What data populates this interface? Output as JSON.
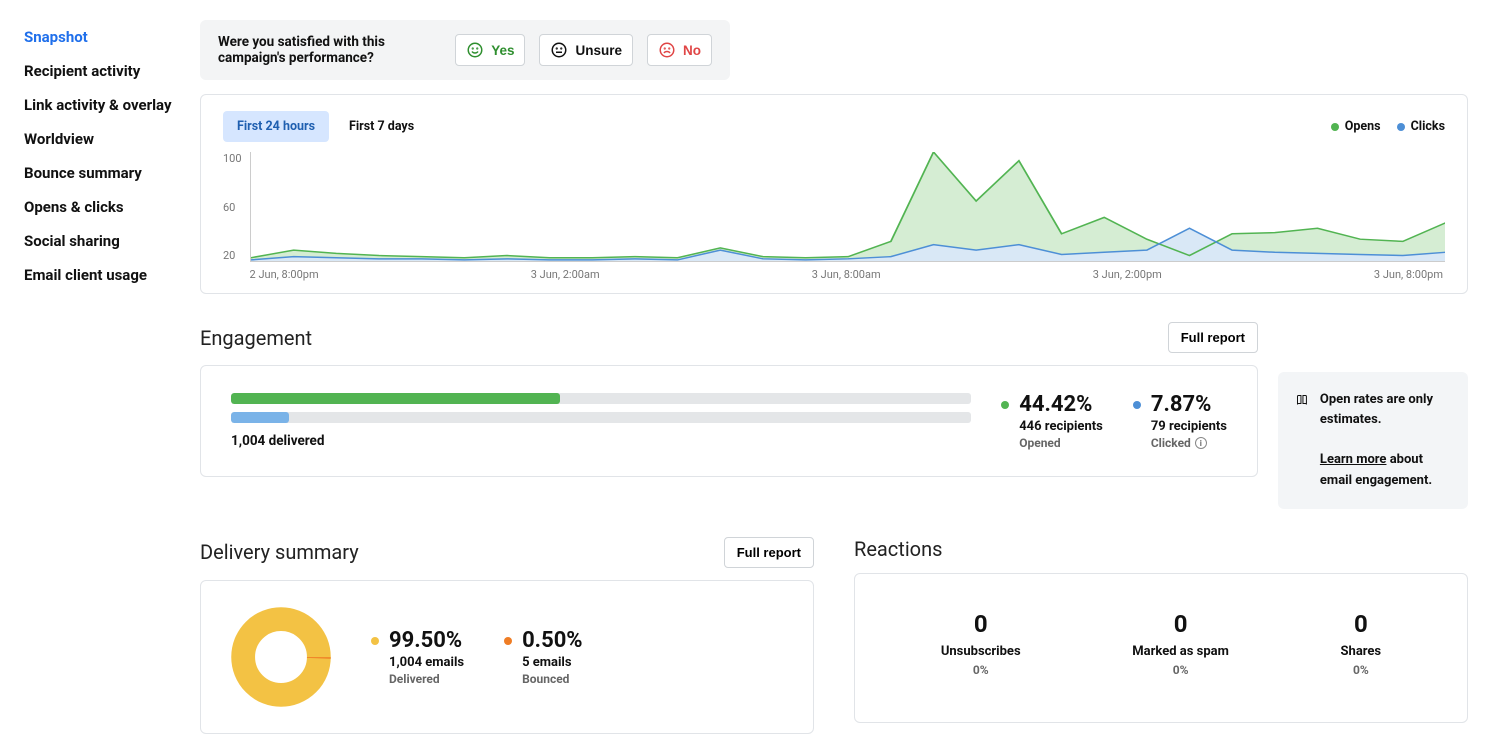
{
  "sidebar": {
    "items": [
      {
        "label": "Snapshot",
        "active": true
      },
      {
        "label": "Recipient activity"
      },
      {
        "label": "Link activity & overlay"
      },
      {
        "label": "Worldview"
      },
      {
        "label": "Bounce summary"
      },
      {
        "label": "Opens & clicks"
      },
      {
        "label": "Social sharing"
      },
      {
        "label": "Email client usage"
      }
    ]
  },
  "feedback": {
    "question": "Were you satisfied with this campaign's performance?",
    "yes": "Yes",
    "unsure": "Unsure",
    "no": "No"
  },
  "chart": {
    "range24": "First 24 hours",
    "range7": "First 7 days",
    "legend_opens": "Opens",
    "legend_clicks": "Clicks",
    "y_ticks": [
      "100",
      "60",
      "20"
    ],
    "x_ticks": [
      "2 Jun, 8:00pm",
      "3 Jun, 2:00am",
      "3 Jun, 8:00am",
      "3 Jun, 2:00pm",
      "3 Jun, 8:00pm"
    ]
  },
  "engagement": {
    "title": "Engagement",
    "full_report": "Full report",
    "delivered_label": "1,004 delivered",
    "open_pct": "44.42%",
    "open_sub": "446 recipients",
    "open_lbl": "Opened",
    "click_pct": "7.87%",
    "click_sub": "79 recipients",
    "click_lbl": "Clicked",
    "aside_line1": "Open rates are only estimates.",
    "aside_link": "Learn more",
    "aside_line2": " about email engagement."
  },
  "delivery": {
    "title": "Delivery summary",
    "full_report": "Full report",
    "delivered_pct": "99.50%",
    "delivered_sub": "1,004 emails",
    "delivered_lbl": "Delivered",
    "bounced_pct": "0.50%",
    "bounced_sub": "5 emails",
    "bounced_lbl": "Bounced"
  },
  "reactions": {
    "title": "Reactions",
    "cols": [
      {
        "val": "0",
        "label": "Unsubscribes",
        "pct": "0%"
      },
      {
        "val": "0",
        "label": "Marked as spam",
        "pct": "0%"
      },
      {
        "val": "0",
        "label": "Shares",
        "pct": "0%"
      }
    ]
  },
  "chart_data": {
    "type": "area",
    "x": [
      "2 Jun, 8:00pm",
      "2 Jun, 9:00pm",
      "2 Jun, 10:00pm",
      "2 Jun, 11:00pm",
      "3 Jun, 12:00am",
      "3 Jun, 1:00am",
      "3 Jun, 2:00am",
      "3 Jun, 3:00am",
      "3 Jun, 4:00am",
      "3 Jun, 5:00am",
      "3 Jun, 6:00am",
      "3 Jun, 7:00am",
      "3 Jun, 8:00am",
      "3 Jun, 9:00am",
      "3 Jun, 10:00am",
      "3 Jun, 11:00am",
      "3 Jun, 12:00pm",
      "3 Jun, 1:00pm",
      "3 Jun, 2:00pm",
      "3 Jun, 3:00pm",
      "3 Jun, 4:00pm",
      "3 Jun, 5:00pm",
      "3 Jun, 6:00pm",
      "3 Jun, 7:00pm",
      "3 Jun, 8:00pm"
    ],
    "series": [
      {
        "name": "Opens",
        "values": [
          3,
          10,
          7,
          5,
          4,
          3,
          5,
          3,
          3,
          4,
          3,
          12,
          4,
          3,
          4,
          18,
          100,
          55,
          92,
          25,
          40,
          20,
          5,
          25,
          26,
          30,
          20,
          18,
          35
        ]
      },
      {
        "name": "Clicks",
        "values": [
          1,
          4,
          3,
          2,
          2,
          1,
          2,
          1,
          1,
          2,
          1,
          10,
          2,
          1,
          2,
          4,
          15,
          10,
          15,
          6,
          8,
          10,
          30,
          10,
          8,
          7,
          6,
          5,
          8
        ]
      }
    ],
    "ylim": [
      0,
      100
    ],
    "title": "",
    "xlabel": "",
    "ylabel": ""
  },
  "colors": {
    "green": "#52b452",
    "blue": "#4d8fd6",
    "yellow": "#f3c244",
    "orange": "#ef7d25"
  }
}
